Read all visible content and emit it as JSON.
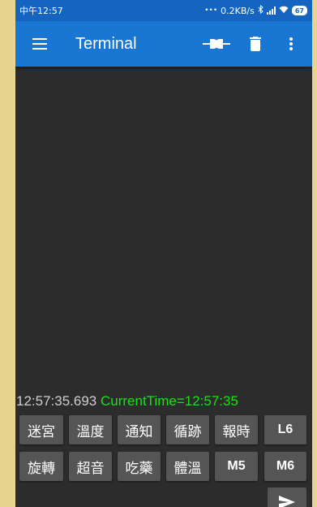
{
  "status_bar": {
    "time": "中午12:57",
    "dots": "•••",
    "network_speed": "0.2KB/s",
    "battery_level": "67",
    "icons": [
      "bluetooth-icon",
      "signal-icon",
      "wifi-icon",
      "battery-icon"
    ]
  },
  "app_bar": {
    "title": "Terminal",
    "icons": [
      "menu-icon",
      "connect-icon",
      "delete-icon",
      "more-vert-icon"
    ]
  },
  "terminal": {
    "timestamp": "12:57:35.693",
    "message": "CurrentTime=12:57:35",
    "timestamp_color": "#cfcfcf",
    "message_color": "#19e019"
  },
  "macro_buttons": {
    "row1": [
      "迷宮",
      "溫度",
      "通知",
      "循跡",
      "報時",
      "L6"
    ],
    "row2": [
      "旋轉",
      "超音",
      "吃藥",
      "體溫",
      "M5",
      "M6"
    ]
  },
  "send": {
    "icon": "send-icon"
  },
  "colors": {
    "status_bar": "#1565c0",
    "app_bar": "#1976d2",
    "terminal_bg": "#2c2c2c",
    "button_bg": "#555555",
    "page_bg": "#e7d58f"
  }
}
